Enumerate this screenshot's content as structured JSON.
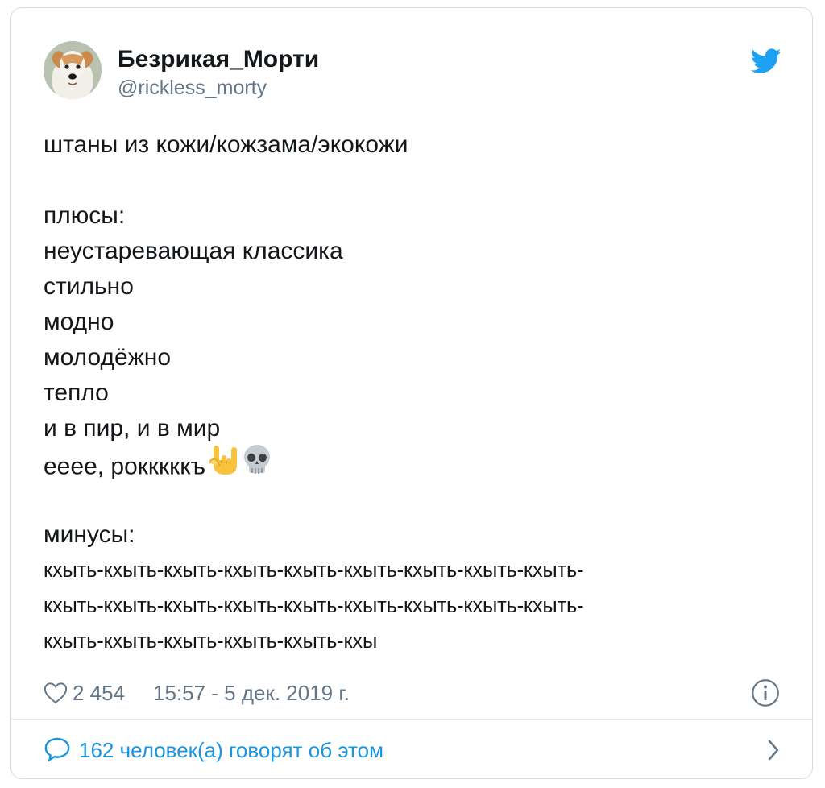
{
  "user": {
    "display_name": "Безрикая_Морти",
    "handle": "@rickless_morty",
    "avatar_icon": "dog-avatar"
  },
  "tweet": {
    "title_line": "штаны из кожи/кожзама/экокожи",
    "pros_label": "плюсы:",
    "pros": [
      "неустаревающая классика",
      "стильно",
      "модно",
      "молодёжно",
      "тепло",
      "и в пир, и в мир",
      "ееее, рокккккъ"
    ],
    "pros_emoji": [
      "sign-of-horns-emoji",
      "skull-emoji"
    ],
    "cons_label": "минусы:",
    "cons_lines": [
      "кхыть-кхыть-кхыть-кхыть-кхыть-кхыть-кхыть-кхыть-кхыть-",
      "кхыть-кхыть-кхыть-кхыть-кхыть-кхыть-кхыть-кхыть-кхыть-",
      "кхыть-кхыть-кхыть-кхыть-кхыть-кхы"
    ]
  },
  "meta": {
    "like_count": "2 454",
    "timestamp": "15:57 - 5 дек. 2019 г."
  },
  "footer": {
    "replies_text": "162 человек(а) говорят об этом"
  },
  "colors": {
    "twitter_blue": "#1da1f2",
    "link_blue": "#1b95e0",
    "secondary_text": "#657786",
    "border": "#d5dde3"
  }
}
